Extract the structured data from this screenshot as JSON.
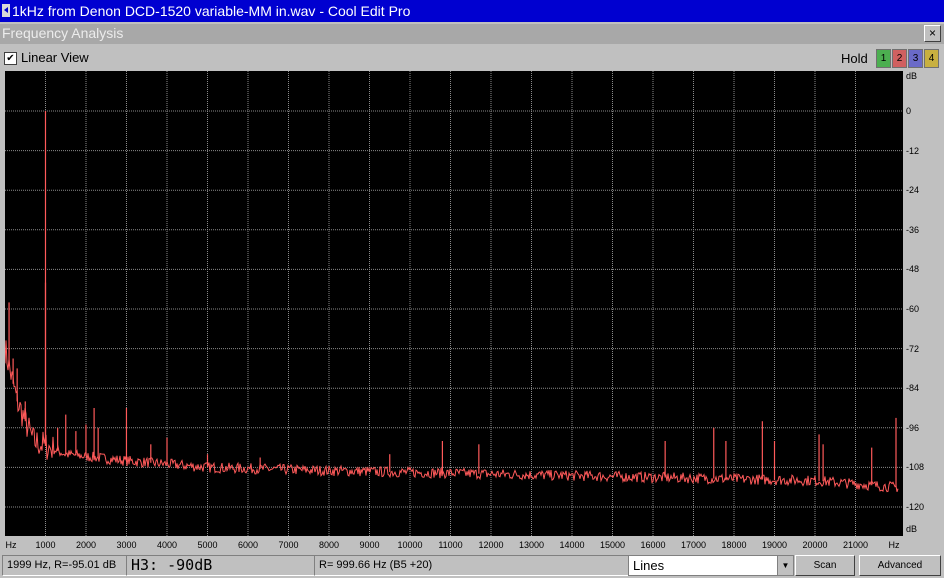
{
  "window": {
    "title": "1kHz from Denon DCD-1520 variable-MM in.wav - Cool Edit Pro"
  },
  "panel": {
    "title": "Frequency Analysis",
    "close": "×"
  },
  "options": {
    "linear_view_label": "Linear View",
    "linear_view_checked": true,
    "check_mark": "✔",
    "hold_label": "Hold",
    "hold_buttons": [
      "1",
      "2",
      "3",
      "4"
    ]
  },
  "colors": {
    "trace": "#ff5a5a",
    "grid": "#8a8a8a",
    "plot_bg": "#000000",
    "hold": [
      "#4caf50",
      "#d06060",
      "#6a6ac8",
      "#c8b040"
    ]
  },
  "status": {
    "cursor": "1999 Hz, R=-95.01 dB",
    "harmonic": "H3: -90dB",
    "reference": "R= 999.66 Hz (B5 +20)",
    "mode": "Lines",
    "scan": "Scan",
    "advanced": "Advanced"
  },
  "chart_data": {
    "type": "line",
    "xlabel": "Hz",
    "ylabel": "dB",
    "xlim": [
      0,
      22050
    ],
    "ylim": [
      -123,
      0
    ],
    "x_ticks": [
      "Hz",
      "1000",
      "2000",
      "3000",
      "4000",
      "5000",
      "6000",
      "7000",
      "8000",
      "9000",
      "10000",
      "11000",
      "12000",
      "13000",
      "14000",
      "15000",
      "16000",
      "17000",
      "18000",
      "19000",
      "20000",
      "21000",
      "Hz"
    ],
    "y_ticks": [
      "dB",
      "0",
      "-12",
      "-24",
      "-36",
      "-48",
      "-60",
      "-72",
      "-84",
      "-96",
      "-108",
      "-120",
      "dB"
    ],
    "grid": true,
    "noise_floor": [
      [
        0,
        -72
      ],
      [
        300,
        -88
      ],
      [
        700,
        -100
      ],
      [
        1500,
        -104
      ],
      [
        3000,
        -106
      ],
      [
        5000,
        -108
      ],
      [
        8000,
        -109
      ],
      [
        12000,
        -110
      ],
      [
        16000,
        -111
      ],
      [
        20000,
        -112
      ],
      [
        22000,
        -114
      ]
    ],
    "peaks": [
      {
        "x": 100,
        "y": -58
      },
      {
        "x": 200,
        "y": -75
      },
      {
        "x": 300,
        "y": -78
      },
      {
        "x": 500,
        "y": -88
      },
      {
        "x": 999.66,
        "y": 0
      },
      {
        "x": 1000,
        "y": -52
      },
      {
        "x": 1300,
        "y": -96
      },
      {
        "x": 1500,
        "y": -92
      },
      {
        "x": 1750,
        "y": -97
      },
      {
        "x": 1999,
        "y": -95
      },
      {
        "x": 2200,
        "y": -90
      },
      {
        "x": 2300,
        "y": -96
      },
      {
        "x": 2999,
        "y": -90
      },
      {
        "x": 3600,
        "y": -101
      },
      {
        "x": 4000,
        "y": -99
      },
      {
        "x": 5000,
        "y": -104
      },
      {
        "x": 6300,
        "y": -105
      },
      {
        "x": 9500,
        "y": -104
      },
      {
        "x": 10800,
        "y": -100
      },
      {
        "x": 11700,
        "y": -101
      },
      {
        "x": 16300,
        "y": -100
      },
      {
        "x": 17500,
        "y": -96
      },
      {
        "x": 17800,
        "y": -100
      },
      {
        "x": 18700,
        "y": -94
      },
      {
        "x": 19000,
        "y": -100
      },
      {
        "x": 20100,
        "y": -98
      },
      {
        "x": 20200,
        "y": -101
      },
      {
        "x": 21400,
        "y": -102
      },
      {
        "x": 22000,
        "y": -93
      }
    ]
  }
}
